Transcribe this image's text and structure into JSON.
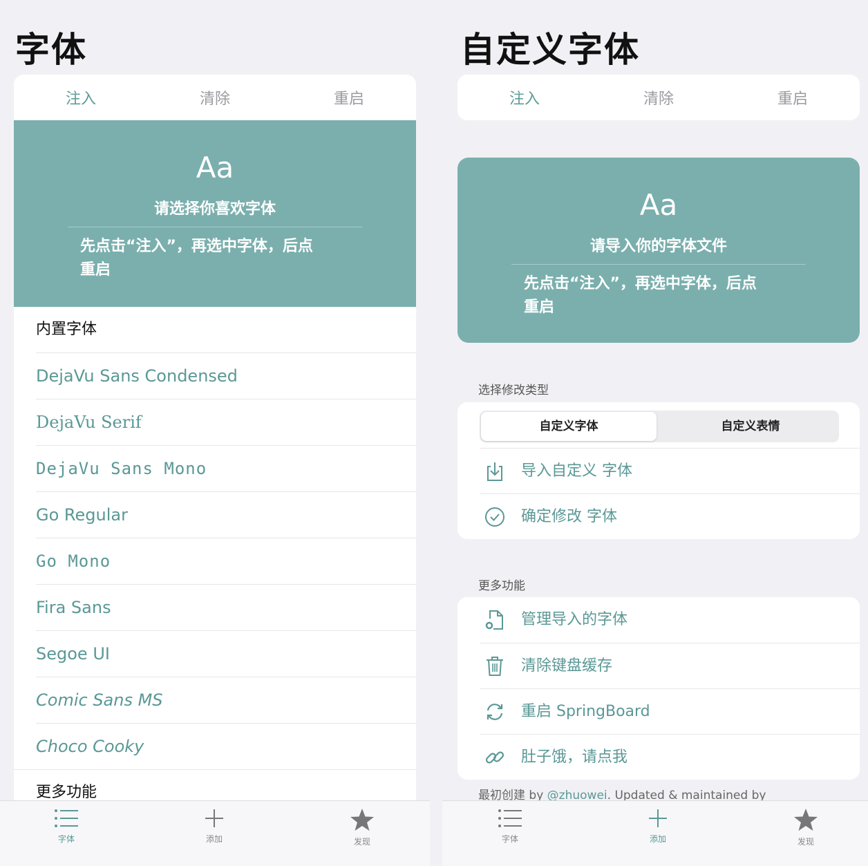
{
  "left": {
    "title": "字体",
    "top_tabs": [
      "注入",
      "清除",
      "重启"
    ],
    "hero": {
      "aa": "Aa",
      "subtitle": "请选择你喜欢字体",
      "instruction_line1": "先点击“注入”，再选中字体，后点",
      "instruction_line2": "重启"
    },
    "list_header": "内置字体",
    "fonts": [
      "DejaVu Sans Condensed",
      "DejaVu Serif",
      "DejaVu Sans Mono",
      "Go Regular",
      "Go Mono",
      "Fira Sans",
      "Segoe UI",
      "Comic Sans MS",
      "Choco Cooky"
    ],
    "more_header": "更多功能",
    "bottom_tabs": [
      "字体",
      "添加",
      "发现"
    ]
  },
  "right": {
    "title": "自定义字体",
    "top_tabs": [
      "注入",
      "清除",
      "重启"
    ],
    "hero": {
      "aa": "Aa",
      "subtitle": "请导入你的字体文件",
      "instruction_line1": "先点击“注入”，再选中字体，后点",
      "instruction_line2": "重启"
    },
    "type_section_label": "选择修改类型",
    "segment": {
      "selected": "自定义字体",
      "other": "自定义表情"
    },
    "type_rows": [
      {
        "icon": "import-icon",
        "label": "导入自定义 字体"
      },
      {
        "icon": "check-circle-icon",
        "label": "确定修改 字体"
      }
    ],
    "more_section_label": "更多功能",
    "more_rows": [
      {
        "icon": "file-gear-icon",
        "label": "管理导入的字体"
      },
      {
        "icon": "trash-icon",
        "label": "清除键盘缓存"
      },
      {
        "icon": "refresh-icon",
        "label": "重启 SpringBoard"
      },
      {
        "icon": "link-icon",
        "label": "肚子饿，请点我"
      }
    ],
    "footer_prefix": "最初创建 by ",
    "footer_link": "@zhuowei",
    "footer_suffix": ". Updated & maintained by",
    "bottom_tabs": [
      "字体",
      "添加",
      "发现"
    ]
  },
  "colors": {
    "accent": "#5a9896",
    "hero_bg": "#7aafad",
    "page_bg": "#f1f1f5"
  }
}
